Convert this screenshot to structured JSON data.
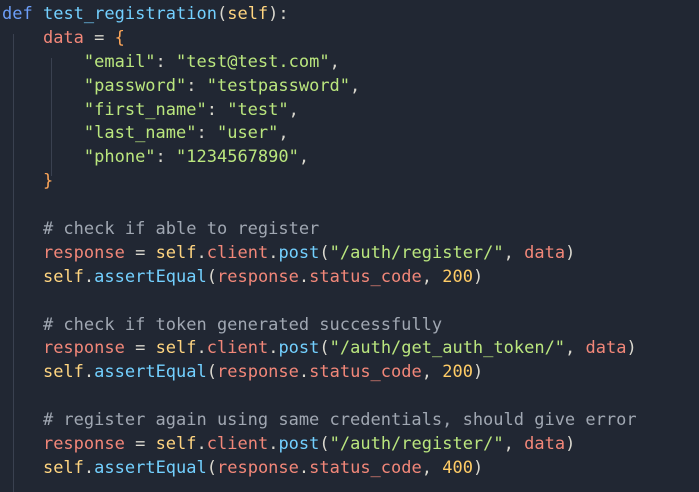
{
  "code": {
    "line1": {
      "kw": "def",
      "fn": "test_registration",
      "paren_open": "(",
      "param": "self",
      "paren_close": "):"
    },
    "line2": {
      "var": "data",
      "op": " = ",
      "brace": "{"
    },
    "line3": {
      "key": "\"email\"",
      "colon": ": ",
      "value": "\"test@test.com\"",
      "comma": ","
    },
    "line4": {
      "key": "\"password\"",
      "colon": ": ",
      "value": "\"testpassword\"",
      "comma": ","
    },
    "line5": {
      "key": "\"first_name\"",
      "colon": ": ",
      "value": "\"test\"",
      "comma": ","
    },
    "line6": {
      "key": "\"last_name\"",
      "colon": ": ",
      "value": "\"user\"",
      "comma": ","
    },
    "line7": {
      "key": "\"phone\"",
      "colon": ": ",
      "value": "\"1234567890\"",
      "comma": ","
    },
    "line8": {
      "brace": "}"
    },
    "comment1": "# check if able to register",
    "call1": {
      "var": "response",
      "op": " = ",
      "self": "self",
      "dot1": ".",
      "attr": "client",
      "dot2": ".",
      "method": "post",
      "open": "(",
      "url": "\"/auth/register/\"",
      "sep": ", ",
      "arg": "data",
      "close": ")"
    },
    "assert1": {
      "self": "self",
      "dot": ".",
      "method": "assertEqual",
      "open": "(",
      "obj": "response",
      "dot2": ".",
      "prop": "status_code",
      "sep": ", ",
      "num": "200",
      "close": ")"
    },
    "comment2": "# check if token generated successfully",
    "call2": {
      "var": "response",
      "op": " = ",
      "self": "self",
      "dot1": ".",
      "attr": "client",
      "dot2": ".",
      "method": "post",
      "open": "(",
      "url": "\"/auth/get_auth_token/\"",
      "sep": ", ",
      "arg": "data",
      "close": ")"
    },
    "assert2": {
      "self": "self",
      "dot": ".",
      "method": "assertEqual",
      "open": "(",
      "obj": "response",
      "dot2": ".",
      "prop": "status_code",
      "sep": ", ",
      "num": "200",
      "close": ")"
    },
    "comment3": "# register again using same credentials, should give error",
    "call3": {
      "var": "response",
      "op": " = ",
      "self": "self",
      "dot1": ".",
      "attr": "client",
      "dot2": ".",
      "method": "post",
      "open": "(",
      "url": "\"/auth/register/\"",
      "sep": ", ",
      "arg": "data",
      "close": ")"
    },
    "assert3": {
      "self": "self",
      "dot": ".",
      "method": "assertEqual",
      "open": "(",
      "obj": "response",
      "dot2": ".",
      "prop": "status_code",
      "sep": ", ",
      "num": "400",
      "close": ")"
    }
  },
  "colors": {
    "background": "#212733",
    "keyword": "#6c9ef8",
    "string": "#bae67e",
    "variable": "#f28779",
    "number": "#ffcc66",
    "method": "#73d0ff",
    "comment": "#a0a7b2"
  }
}
